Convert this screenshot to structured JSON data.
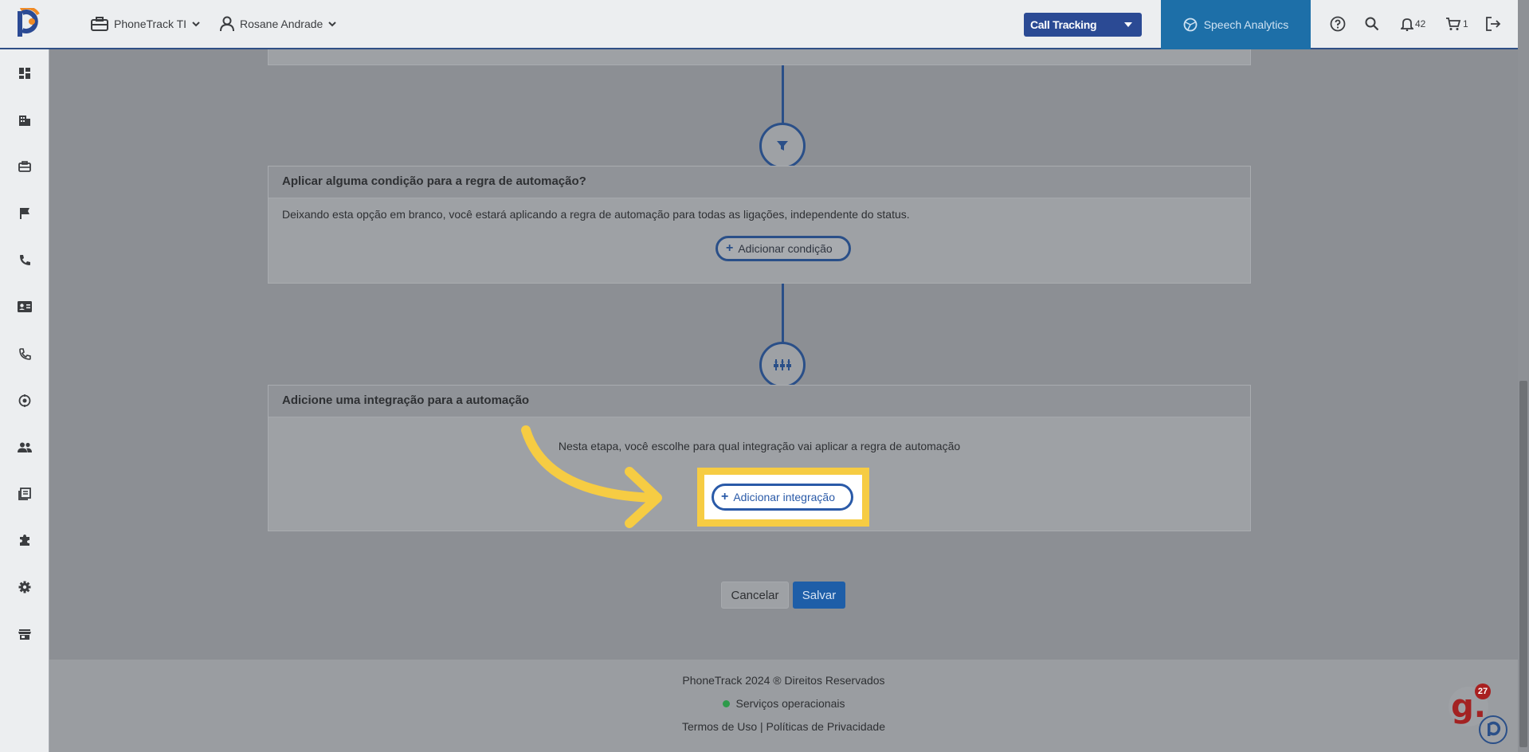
{
  "topbar": {
    "company": "PhoneTrack TI",
    "user": "Rosane Andrade",
    "product_select": "Call Tracking",
    "speech_analytics": "Speech Analytics",
    "notifications_count": "42",
    "cart_count": "1"
  },
  "sidebar": {
    "icons": [
      "dashboard-icon",
      "building-icon",
      "briefcase-icon",
      "flag-icon",
      "phone-icon",
      "contact-card-icon",
      "phone-call-icon",
      "target-icon",
      "people-icon",
      "library-icon",
      "puzzle-icon",
      "gear-icon",
      "store-icon"
    ]
  },
  "condition_card": {
    "title": "Aplicar alguma condição para a regra de automação?",
    "description": "Deixando esta opção em branco, você estará aplicando a regra de automação para todas as ligações, independente do status.",
    "add_button": "Adicionar condição"
  },
  "integration_card": {
    "title": "Adicione uma integração para a automação",
    "description": "Nesta etapa, você escolhe para qual integração vai aplicar a regra de automação",
    "add_button": "Adicionar integração"
  },
  "actions": {
    "cancel": "Cancelar",
    "save": "Salvar"
  },
  "footer": {
    "copyright": "PhoneTrack 2024 ® Direitos Reservados",
    "status": "Serviços operacionais",
    "links": "Termos de Uso | Políticas de Privacidade"
  },
  "widgets": {
    "g_label": "g.",
    "g_count": "27"
  },
  "colors": {
    "accent": "#2a4f88",
    "highlight": "#f6cc43",
    "save": "#1e5ea8",
    "status_ok": "#2e9a4a"
  }
}
